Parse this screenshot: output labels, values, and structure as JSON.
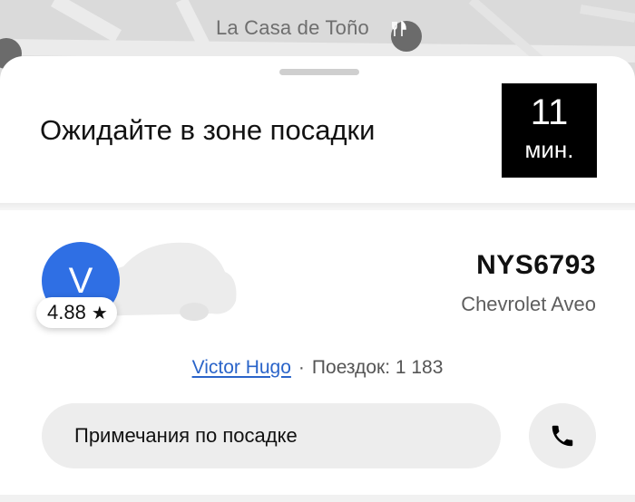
{
  "map": {
    "place_label": "La Casa de Toño",
    "pin_icon": "restaurant-icon"
  },
  "trip_status": {
    "title": "Ожидайте в зоне посадки",
    "eta_value": "11",
    "eta_unit": "мин."
  },
  "driver": {
    "avatar_initial": "V",
    "rating": "4.88",
    "rating_icon": "star-icon",
    "plate": "NYS6793",
    "car_model": "Chevrolet Aveo",
    "name": "Victor Hugo",
    "separator": "·",
    "trips": "Поездок: 1 183"
  },
  "actions": {
    "notes_label": "Примечания по посадке",
    "call_icon": "phone-icon"
  },
  "colors": {
    "avatar": "#2f6fe4",
    "driver_link": "#2a64c9",
    "eta_background": "#000000"
  }
}
